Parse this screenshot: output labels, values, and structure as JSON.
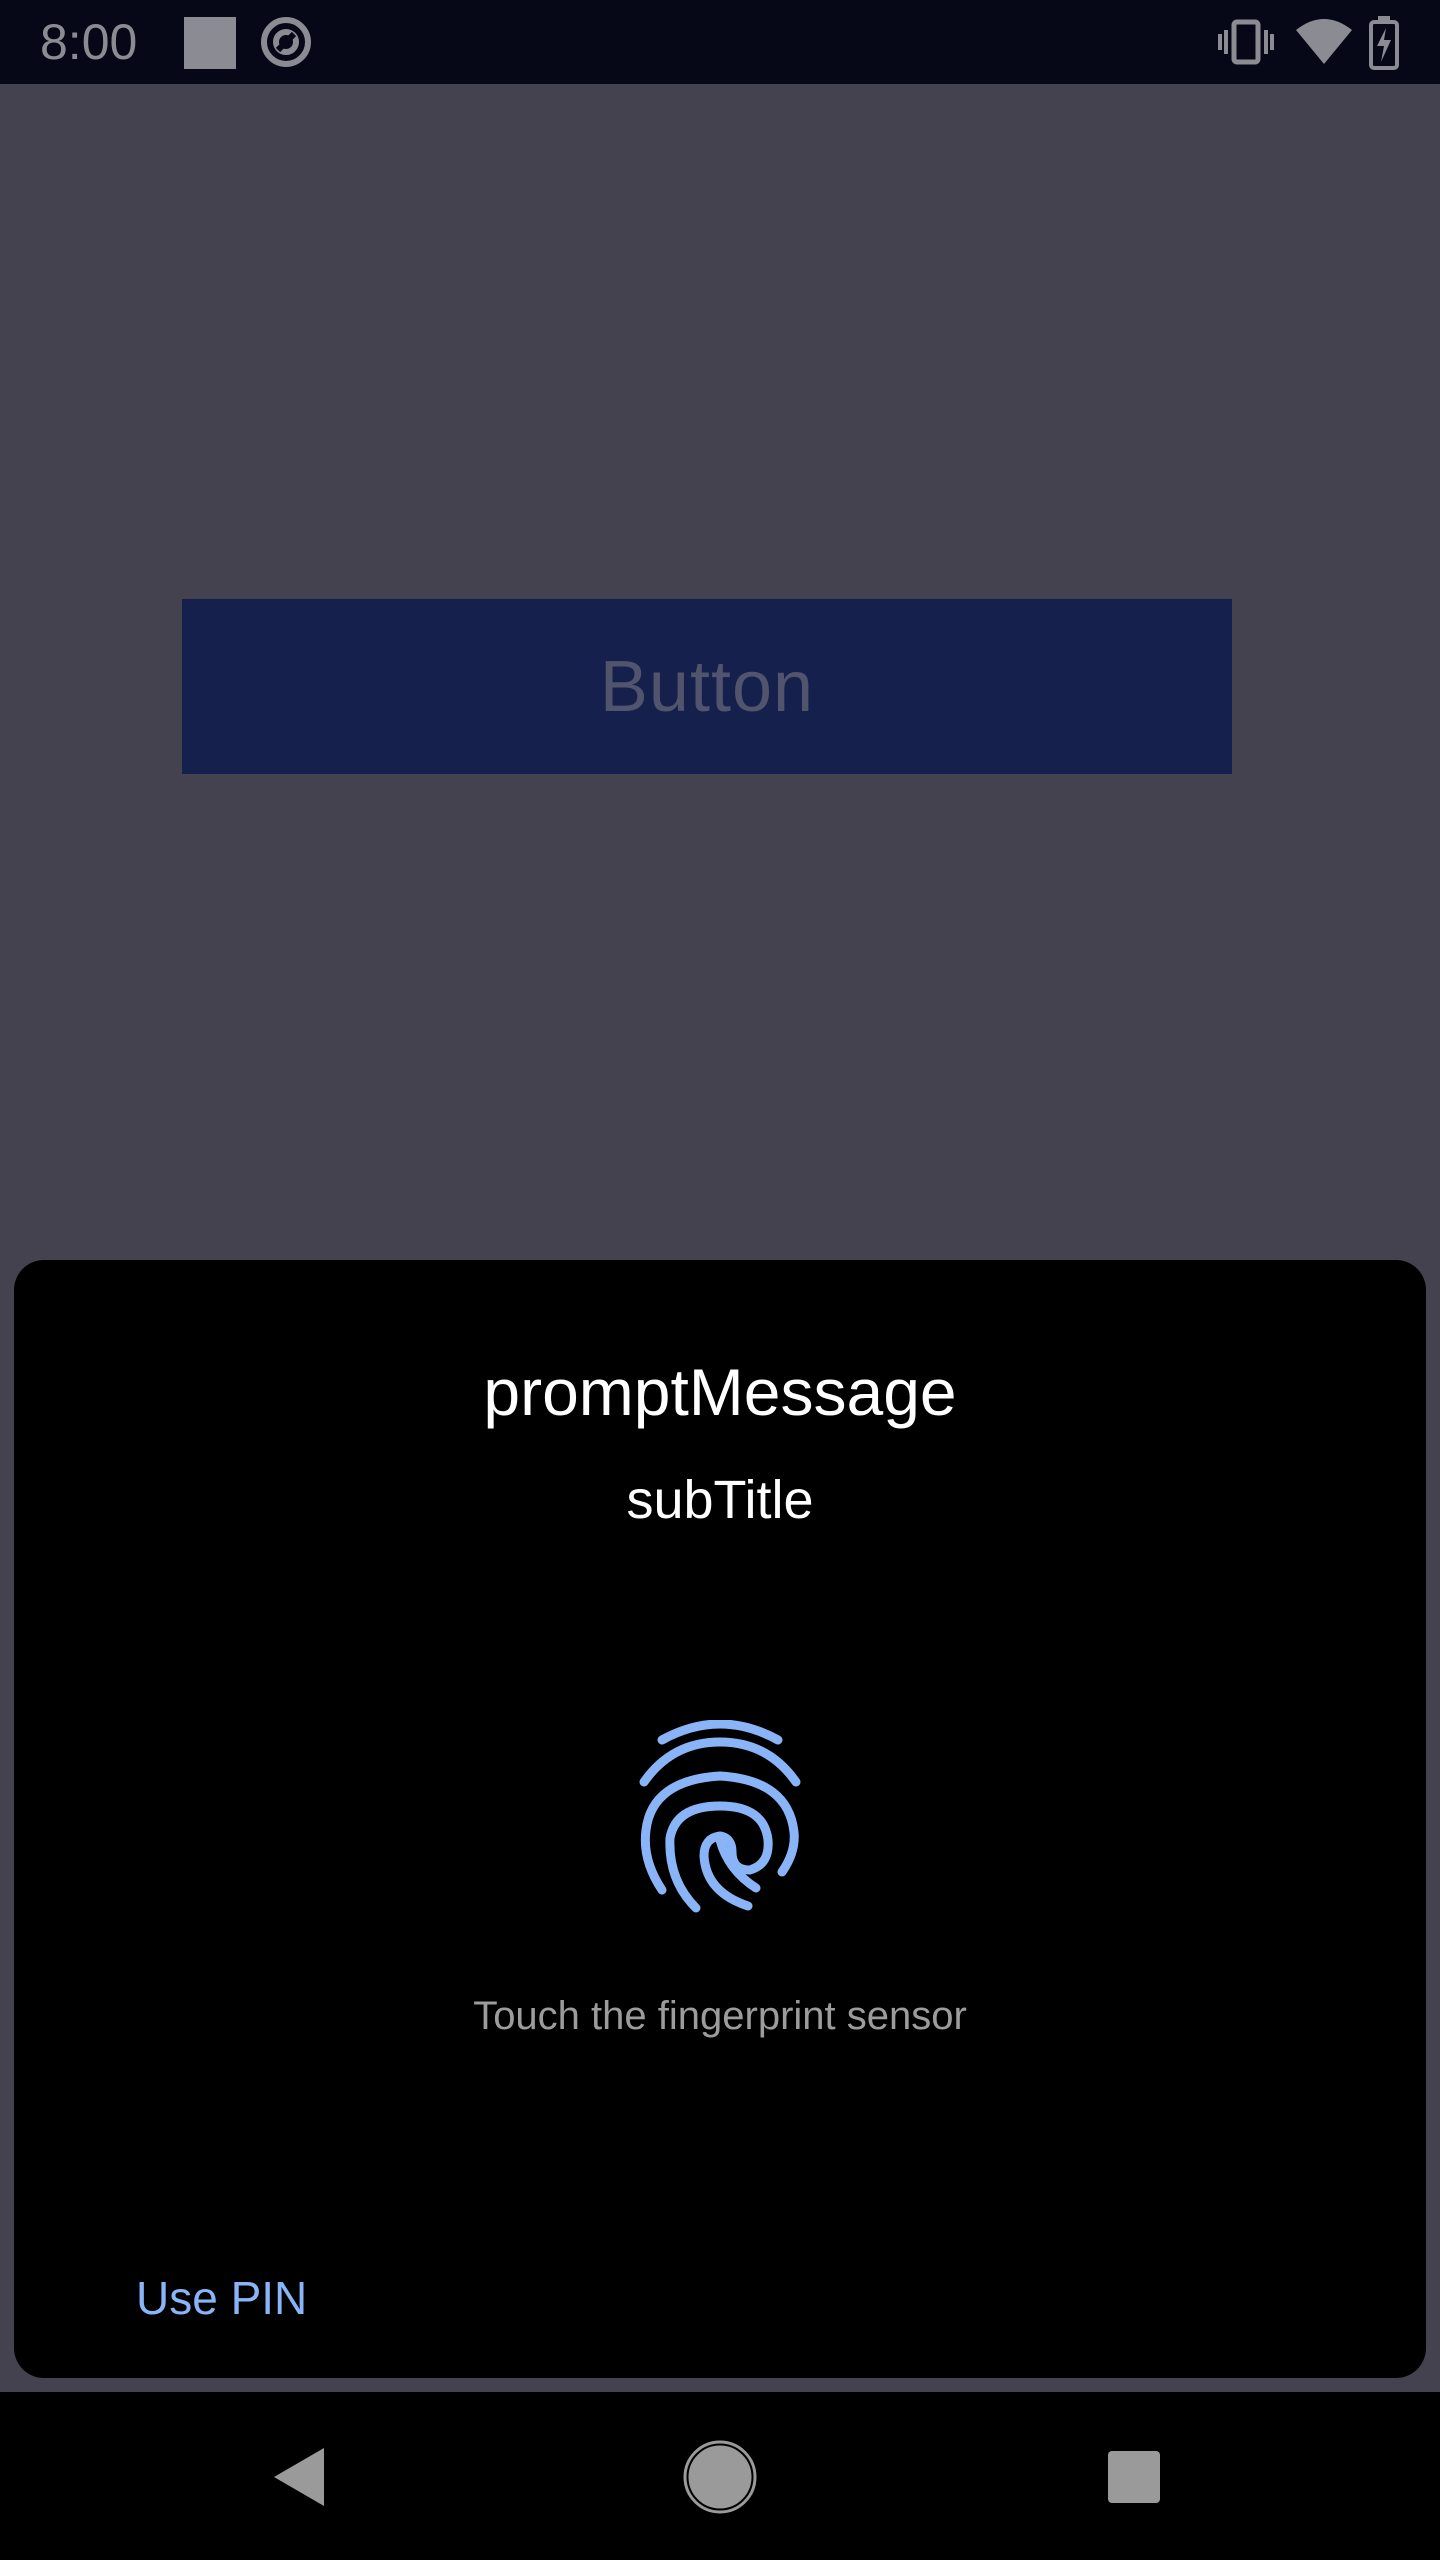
{
  "status_bar": {
    "time": "8:00",
    "icons": [
      "notification-square-icon",
      "sync-icon",
      "vibrate-icon",
      "wifi-icon",
      "battery-charging-icon"
    ]
  },
  "app": {
    "button_label": "Button",
    "button_color": "#16204c",
    "background_color": "#43424e"
  },
  "dialog": {
    "title": "promptMessage",
    "subtitle": "subTitle",
    "hint": "Touch the fingerprint sensor",
    "use_pin_label": "Use PIN",
    "accent_color": "#8ab4f8"
  },
  "nav_bar": {
    "icons": [
      "back-icon",
      "home-icon",
      "recents-icon"
    ]
  }
}
